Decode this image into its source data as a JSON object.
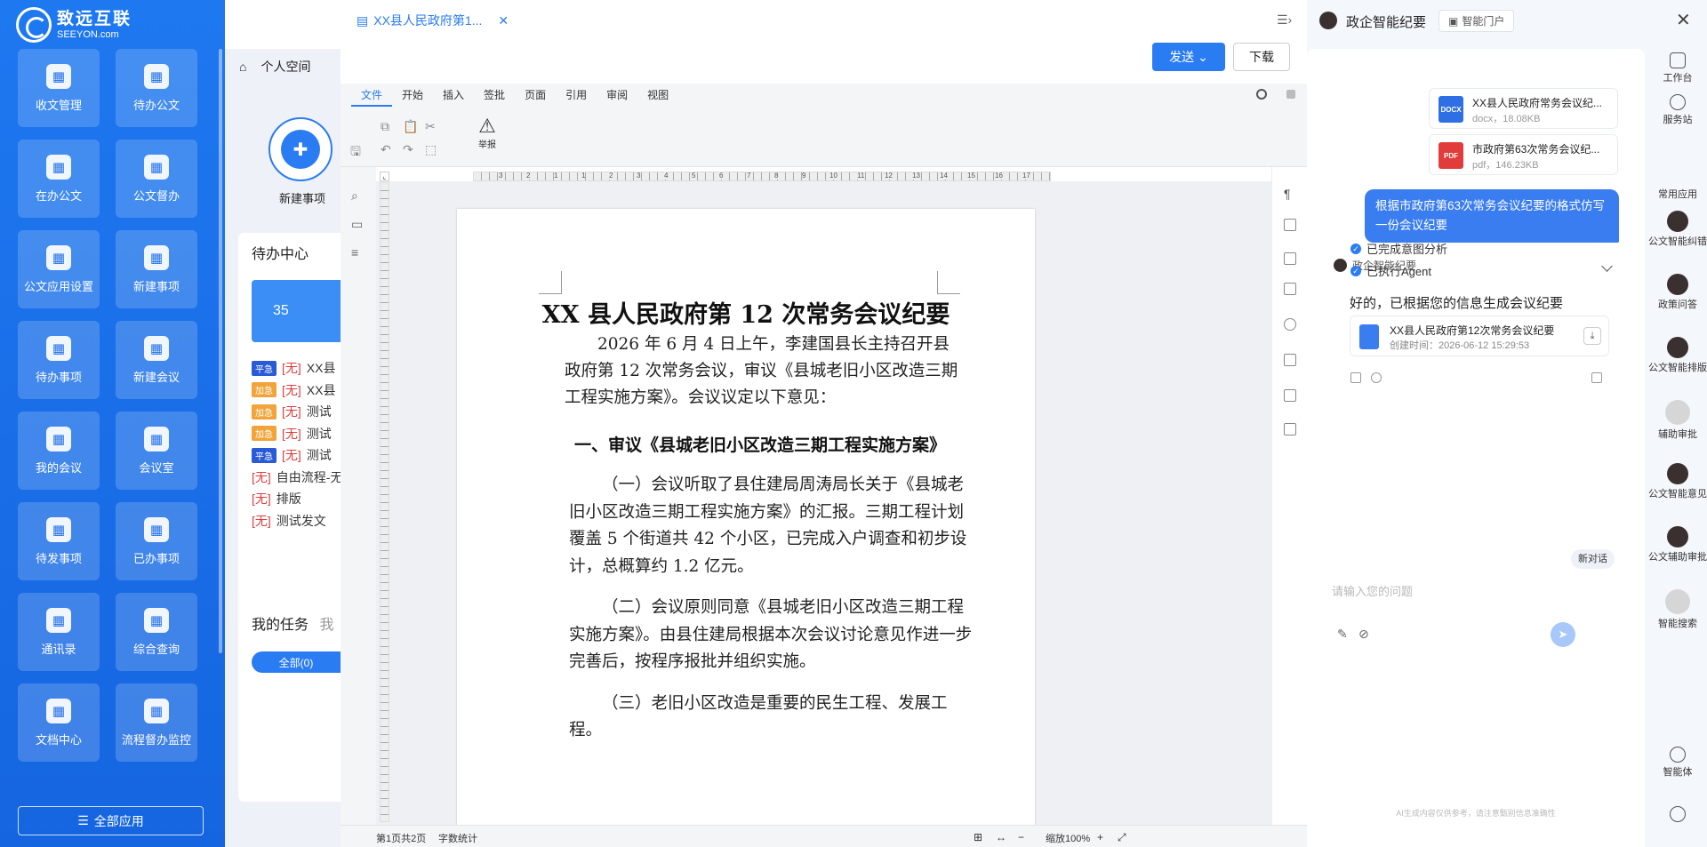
{
  "brand": {
    "name_cn": "致远互联",
    "name_en": "SEEYON.com"
  },
  "left_nav": {
    "tiles": [
      {
        "label": "收文管理",
        "icon": "inbox-doc-icon"
      },
      {
        "label": "待办公文",
        "icon": "pending-doc-icon"
      },
      {
        "label": "在办公文",
        "icon": "processing-doc-icon"
      },
      {
        "label": "公文督办",
        "icon": "supervise-doc-icon"
      },
      {
        "label": "公文应用设置",
        "icon": "doc-settings-icon"
      },
      {
        "label": "新建事项",
        "icon": "new-item-icon"
      },
      {
        "label": "待办事项",
        "icon": "todo-icon"
      },
      {
        "label": "新建会议",
        "icon": "new-meeting-icon"
      },
      {
        "label": "我的会议",
        "icon": "my-meeting-icon"
      },
      {
        "label": "会议室",
        "icon": "meeting-room-icon"
      },
      {
        "label": "待发事项",
        "icon": "to-send-icon"
      },
      {
        "label": "已办事项",
        "icon": "done-icon"
      },
      {
        "label": "通讯录",
        "icon": "contacts-icon"
      },
      {
        "label": "综合查询",
        "icon": "search-icon"
      },
      {
        "label": "文档中心",
        "icon": "document-center-icon"
      },
      {
        "label": "流程督办监控",
        "icon": "flow-monitor-icon"
      }
    ],
    "all_apps_label": "全部应用"
  },
  "workspace": {
    "space_title": "个人空间",
    "new_item_label": "新建事项",
    "todo_center_title": "待办中心",
    "todo_count": "35",
    "todo_rows": [
      {
        "badge": "平急",
        "badge_type": "normal",
        "tag": "[无]",
        "text": "XX县"
      },
      {
        "badge": "加急",
        "badge_type": "urgent",
        "tag": "[无]",
        "text": "XX县"
      },
      {
        "badge": "加急",
        "badge_type": "urgent",
        "tag": "[无]",
        "text": "测试"
      },
      {
        "badge": "加急",
        "badge_type": "urgent",
        "tag": "[无]",
        "text": "测试"
      },
      {
        "badge": "平急",
        "badge_type": "normal",
        "tag": "[无]",
        "text": "测试"
      },
      {
        "badge": "",
        "badge_type": "",
        "tag": "[无]",
        "text": "自由流程-无"
      },
      {
        "badge": "",
        "badge_type": "",
        "tag": "[无]",
        "text": "排版"
      },
      {
        "badge": "",
        "badge_type": "",
        "tag": "[无]",
        "text": "测试发文"
      }
    ],
    "task_title": "我的任务",
    "task_title_extra": "我",
    "task_all_label": "全部(0)"
  },
  "editor": {
    "tab_title": "XX县人民政府第1...",
    "send_label": "发送",
    "download_label": "下载",
    "menus": [
      "文件",
      "开始",
      "插入",
      "签批",
      "页面",
      "引用",
      "审阅",
      "视图"
    ],
    "active_menu": "文件",
    "report_label": "举报",
    "document": {
      "title": "XX 县人民政府第 12 次常务会议纪要",
      "intro": "2026 年 6 月 4 日上午，李建国县长主持召开县政府第 12 次常务会议，审议《县城老旧小区改造三期工程实施方案》。会议议定以下意见：",
      "heading1": "一、审议《县城老旧小区改造三期工程实施方案》",
      "p1": "（一）会议听取了县住建局周涛局长关于《县城老旧小区改造三期工程实施方案》的汇报。三期工程计划覆盖 5 个街道共 42 个小区，已完成入户调查和初步设计，总概算约 1.2 亿元。",
      "p2": "（二）会议原则同意《县城老旧小区改造三期工程实施方案》。由县住建局根据本次会议讨论意见作进一步完善后，按程序报批并组织实施。",
      "p3": "（三）老旧小区改造是重要的民生工程、发展工程。"
    },
    "ruler_numbers": [
      "3",
      "2",
      "1",
      "1",
      "2",
      "3",
      "4",
      "5",
      "6",
      "7",
      "8",
      "9",
      "10",
      "11",
      "12",
      "13",
      "14",
      "15",
      "16",
      "17"
    ],
    "status": {
      "page": "第1页共2页",
      "word_count": "字数统计",
      "zoom": "缩放100%"
    }
  },
  "ai": {
    "title": "政企智能纪要",
    "portal_label": "智能门户",
    "files": [
      {
        "name": "XX县人民政府常务会议纪...",
        "meta": "docx，18.08KB",
        "type": "DOCX",
        "color": "#2f6fe4"
      },
      {
        "name": "市政府第63次常务会议纪...",
        "meta": "pdf，146.23KB",
        "type": "PDF",
        "color": "#e23b3b"
      }
    ],
    "user_message": "根据市政府第63次常务会议纪要的格式仿写一份会议纪要",
    "assistant_name": "政企智能纪要",
    "steps": [
      "已完成意图分析",
      "已执行Agent"
    ],
    "reply": "好的，已根据您的信息生成会议纪要",
    "result": {
      "name": "XX县人民政府第12次常务会议纪要",
      "meta": "创建时间：2026-06-12 15:29:53"
    },
    "new_chat_label": "新对话",
    "input_placeholder": "请输入您的问题",
    "disclaimer": "AI生成内容仅供参考，请注意甄别信息准确性",
    "side": {
      "workbench": "工作台",
      "service": "服务站",
      "common_apps": "常用应用",
      "apps": [
        "公文智能纠错",
        "政策问答",
        "公文智能排版",
        "辅助审批",
        "公文智能意见",
        "公文辅助审批",
        "智能搜索"
      ],
      "agent": "智能体"
    }
  }
}
